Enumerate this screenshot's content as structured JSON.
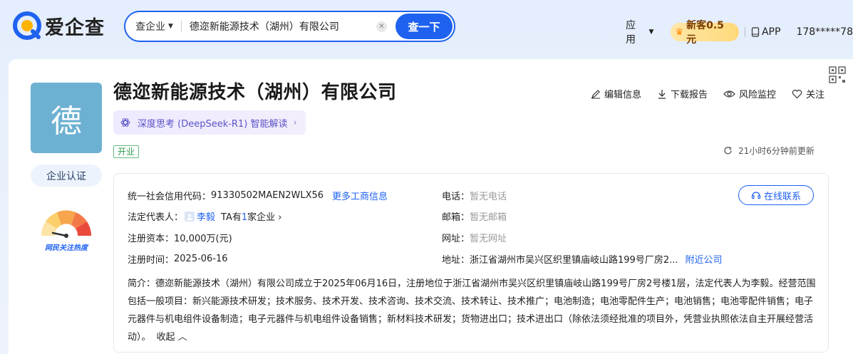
{
  "header": {
    "logo_text": "爱企查",
    "search": {
      "type_label": "查企业",
      "value": "德迩新能源技术（湖州）有限公司",
      "button_label": "查一下"
    },
    "nav": {
      "apps_label": "应用",
      "promo_label": "新客0.5元",
      "app_label": "APP",
      "user_label": "178*****78"
    }
  },
  "company": {
    "avatar_char": "德",
    "name": "德迩新能源技术（湖州）有限公司",
    "ai_chip_label": "深度思考 (DeepSeek-R1) 智能解读",
    "status": "开业",
    "cert_label": "企业认证",
    "heat_label": "网民关注热度",
    "actions": {
      "edit": "编辑信息",
      "download": "下载报告",
      "monitor": "风险监控",
      "follow": "关注"
    },
    "updated": "21小时6分钟前更新"
  },
  "info": {
    "credit_code_label": "统一社会信用代码：",
    "credit_code": "91330502MAEN2WLX56",
    "more_link": "更多工商信息",
    "legal_rep_label": "法定代表人：",
    "legal_rep": "李毅",
    "legal_rep_extra_prefix": "TA有",
    "legal_rep_extra_count": "1",
    "legal_rep_extra_suffix": "家企业",
    "capital_label": "注册资本：",
    "capital": "10,000万(元)",
    "reg_date_label": "注册时间：",
    "reg_date": "2025-06-16",
    "phone_label": "电话：",
    "phone": "暂无电话",
    "email_label": "邮箱：",
    "email": "暂无邮箱",
    "website_label": "网址：",
    "website": "暂无网址",
    "address_label": "地址：",
    "address": "浙江省湖州市吴兴区织里镇庙岐山路199号厂房2...",
    "nearby_link": "附近公司",
    "contact_button": "在线联系",
    "summary_label": "简介：",
    "summary": "德迩新能源技术（湖州）有限公司成立于2025年06月16日，注册地位于浙江省湖州市吴兴区织里镇庙岐山路199号厂房2号楼1层，法定代表人为李毅。经营范围包括一般项目：新兴能源技术研发；技术服务、技术开发、技术咨询、技术交流、技术转让、技术推广；电池制造；电池零配件生产；电池销售；电池零配件销售；电子元器件与机电组件设备制造；电子元器件与机电组件设备销售；新材料技术研发；货物进出口；技术进出口（除依法须经批准的项目外，凭营业执照依法自主开展经营活动）。",
    "collapse_label": "收起"
  },
  "colors": {
    "brand_blue": "#1f62f0",
    "avatar_bg": "#6db1d2",
    "status_green": "#2e9b4d"
  }
}
